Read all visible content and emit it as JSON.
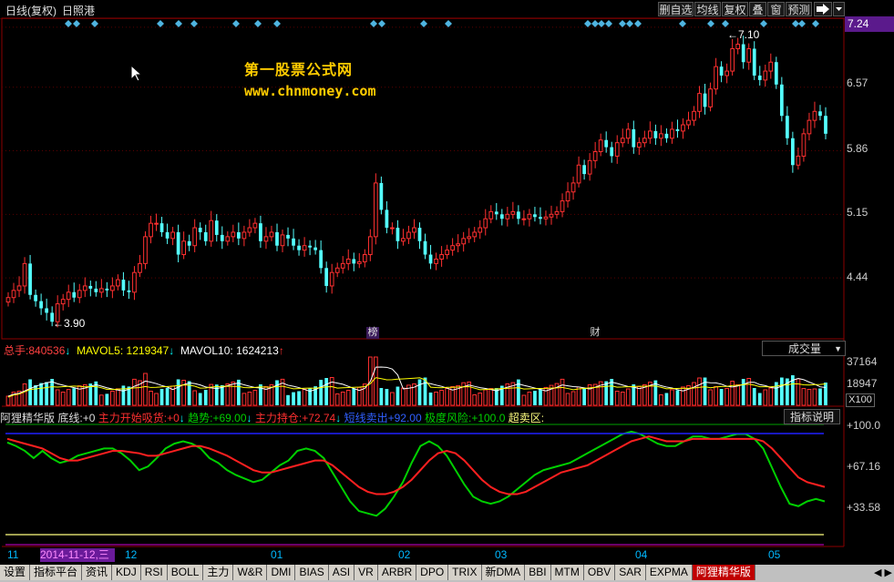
{
  "window": {
    "title": "日线(复权)",
    "stock_name": "日照港"
  },
  "toolbar": {
    "buttons": [
      "删自选",
      "均线",
      "复权",
      "叠",
      "窗",
      "预测"
    ],
    "arrow_icon": "exit-arrow-icon",
    "dropdown_icon": "dropdown-icon"
  },
  "watermark": {
    "line1": "第一股票公式网",
    "line2": "www.chnmoney.com"
  },
  "price_axis": {
    "labels": [
      "7.24",
      "6.57",
      "5.86",
      "5.15",
      "4.44"
    ]
  },
  "price_annotations": {
    "high": "7.10",
    "low": "3.90",
    "bang": "榜",
    "cai": "财"
  },
  "volume": {
    "total_label": "总手:",
    "total_value": "840536",
    "total_arrow": "↓",
    "mavol5_label": "MAVOL5:",
    "mavol5_value": "1219347",
    "mavol5_arrow": "↓",
    "mavol10_label": "MAVOL10:",
    "mavol10_value": "1624213",
    "mavol10_arrow": "↑",
    "selector": "成交量",
    "axis": [
      "37164",
      "18947",
      "X100"
    ]
  },
  "indicator": {
    "name": "阿狸精华版",
    "items": [
      {
        "label": "底线:",
        "value": "+0",
        "arrow": ""
      },
      {
        "label": "主力开始吸货:",
        "value": "+0",
        "arrow": "↓"
      },
      {
        "label": "趋势:",
        "value": "+69.00",
        "arrow": "↓"
      },
      {
        "label": "主力持仓:",
        "value": "+72.74",
        "arrow": "↓"
      },
      {
        "label": "短线卖出",
        "value": "+92.00",
        "arrow": ""
      },
      {
        "label": "极度风险:",
        "value": "+100.0",
        "arrow": ""
      },
      {
        "label": "超卖区:",
        "value": "",
        "arrow": ""
      }
    ],
    "button": "指标说明",
    "axis": [
      "+100.0",
      "+67.16",
      "+33.58"
    ]
  },
  "date_axis": {
    "labels": [
      "11",
      "12",
      "01",
      "02",
      "03",
      "04",
      "05"
    ],
    "selected": "2014-11-12,三"
  },
  "tabs": [
    "设置",
    "指标平台",
    "资讯",
    "KDJ",
    "RSI",
    "BOLL",
    "主力",
    "W&R",
    "DMI",
    "BIAS",
    "ASI",
    "VR",
    "ARBR",
    "DPO",
    "TRIX",
    "新DMA",
    "BBI",
    "MTM",
    "OBV",
    "SAR",
    "EXPMA",
    "阿狸精华版"
  ],
  "active_tab": "阿狸精华版",
  "colors": {
    "up": "#ff3030",
    "down": "#54ffff",
    "accent": "#5b1a8c",
    "gold": "#ffcc00",
    "green": "#00d000"
  },
  "chart_data": [
    {
      "type": "candlestick",
      "title": "日照港",
      "y_range": [
        3.8,
        7.3
      ],
      "y_ticks": [
        7.24,
        6.57,
        5.86,
        5.15,
        4.44
      ],
      "x_ticks": [
        "11",
        "12",
        "01",
        "02",
        "03",
        "04",
        "05"
      ],
      "annotations": [
        {
          "label": "7.10",
          "value": 7.1
        },
        {
          "label": "3.90",
          "value": 3.9
        }
      ],
      "closes": [
        4.22,
        4.3,
        4.35,
        4.6,
        4.25,
        4.18,
        4.1,
        4.05,
        3.95,
        4.15,
        4.2,
        4.28,
        4.22,
        4.3,
        4.35,
        4.32,
        4.28,
        4.32,
        4.3,
        4.35,
        4.42,
        4.3,
        4.28,
        4.5,
        4.6,
        4.9,
        5.05,
        5.05,
        4.95,
        4.88,
        4.95,
        4.7,
        4.85,
        4.8,
        5.0,
        4.95,
        4.85,
        5.08,
        4.92,
        4.85,
        4.9,
        4.95,
        4.88,
        4.95,
        5.0,
        5.05,
        4.85,
        4.9,
        4.95,
        4.8,
        4.92,
        4.88,
        4.8,
        4.75,
        4.8,
        4.78,
        4.75,
        4.55,
        4.35,
        4.5,
        4.55,
        4.6,
        4.65,
        4.6,
        4.62,
        4.7,
        4.9,
        5.5,
        5.2,
        5.0,
        5.0,
        4.85,
        4.88,
        4.95,
        5.0,
        4.85,
        4.7,
        4.6,
        4.65,
        4.7,
        4.75,
        4.8,
        4.82,
        4.88,
        4.9,
        4.95,
        5.0,
        5.1,
        5.18,
        5.15,
        5.1,
        5.15,
        5.18,
        5.1,
        5.1,
        5.15,
        5.12,
        5.1,
        5.12,
        5.15,
        5.18,
        5.3,
        5.4,
        5.5,
        5.7,
        5.6,
        5.75,
        5.85,
        5.98,
        5.9,
        5.8,
        5.95,
        6.0,
        6.1,
        5.9,
        5.95,
        6.0,
        6.08,
        6.0,
        6.05,
        6.0,
        6.1,
        6.08,
        6.15,
        6.2,
        6.3,
        6.5,
        6.35,
        6.55,
        6.8,
        6.7,
        6.75,
        7.0,
        7.05,
        6.85,
        7.0,
        6.7,
        6.65,
        6.75,
        6.85,
        6.6,
        6.25,
        6.0,
        5.7,
        5.8,
        6.05,
        6.2,
        6.3,
        6.25,
        6.05
      ]
    },
    {
      "type": "bar",
      "title": "成交量",
      "y_ticks": [
        37164,
        18947
      ],
      "unit": "X100",
      "series": [
        {
          "name": "成交量"
        },
        {
          "name": "MAVOL5",
          "value": 1219347
        },
        {
          "name": "MAVOL10",
          "value": 1624213
        }
      ]
    },
    {
      "type": "line",
      "title": "阿狸精华版",
      "y_range": [
        0,
        100
      ],
      "y_ticks": [
        100.0,
        67.16,
        33.58
      ],
      "series": [
        {
          "name": "趋势",
          "values": [
            85,
            82,
            78,
            72,
            78,
            72,
            68,
            70,
            74,
            76,
            78,
            80,
            80,
            76,
            70,
            62,
            65,
            72,
            80,
            84,
            86,
            84,
            80,
            72,
            68,
            62,
            58,
            55,
            52,
            54,
            60,
            66,
            70,
            78,
            80,
            78,
            72,
            60,
            48,
            36,
            28,
            26,
            24,
            30,
            40,
            52,
            68,
            82,
            86,
            82,
            74,
            62,
            50,
            40,
            36,
            34,
            36,
            40,
            46,
            52,
            58,
            62,
            64,
            66,
            68,
            72,
            76,
            80,
            84,
            88,
            92,
            94,
            92,
            88,
            84,
            82,
            82,
            86,
            90,
            90,
            88,
            88,
            90,
            92,
            92,
            88,
            80,
            64,
            48,
            34,
            32,
            36,
            38,
            36
          ]
        },
        {
          "name": "主力持仓",
          "values": [
            88,
            86,
            84,
            82,
            80,
            76,
            72,
            70,
            70,
            72,
            74,
            76,
            78,
            78,
            77,
            76,
            74,
            74,
            76,
            78,
            80,
            82,
            82,
            80,
            77,
            74,
            70,
            66,
            62,
            60,
            60,
            62,
            64,
            66,
            68,
            70,
            70,
            66,
            60,
            54,
            48,
            44,
            42,
            42,
            44,
            48,
            54,
            62,
            70,
            76,
            78,
            76,
            70,
            62,
            54,
            48,
            44,
            42,
            42,
            44,
            48,
            52,
            56,
            60,
            62,
            64,
            66,
            70,
            74,
            78,
            82,
            86,
            88,
            90,
            88,
            86,
            86,
            86,
            88,
            88,
            88,
            88,
            88,
            88,
            88,
            88,
            86,
            80,
            72,
            64,
            56,
            52,
            50,
            48
          ]
        }
      ]
    }
  ]
}
